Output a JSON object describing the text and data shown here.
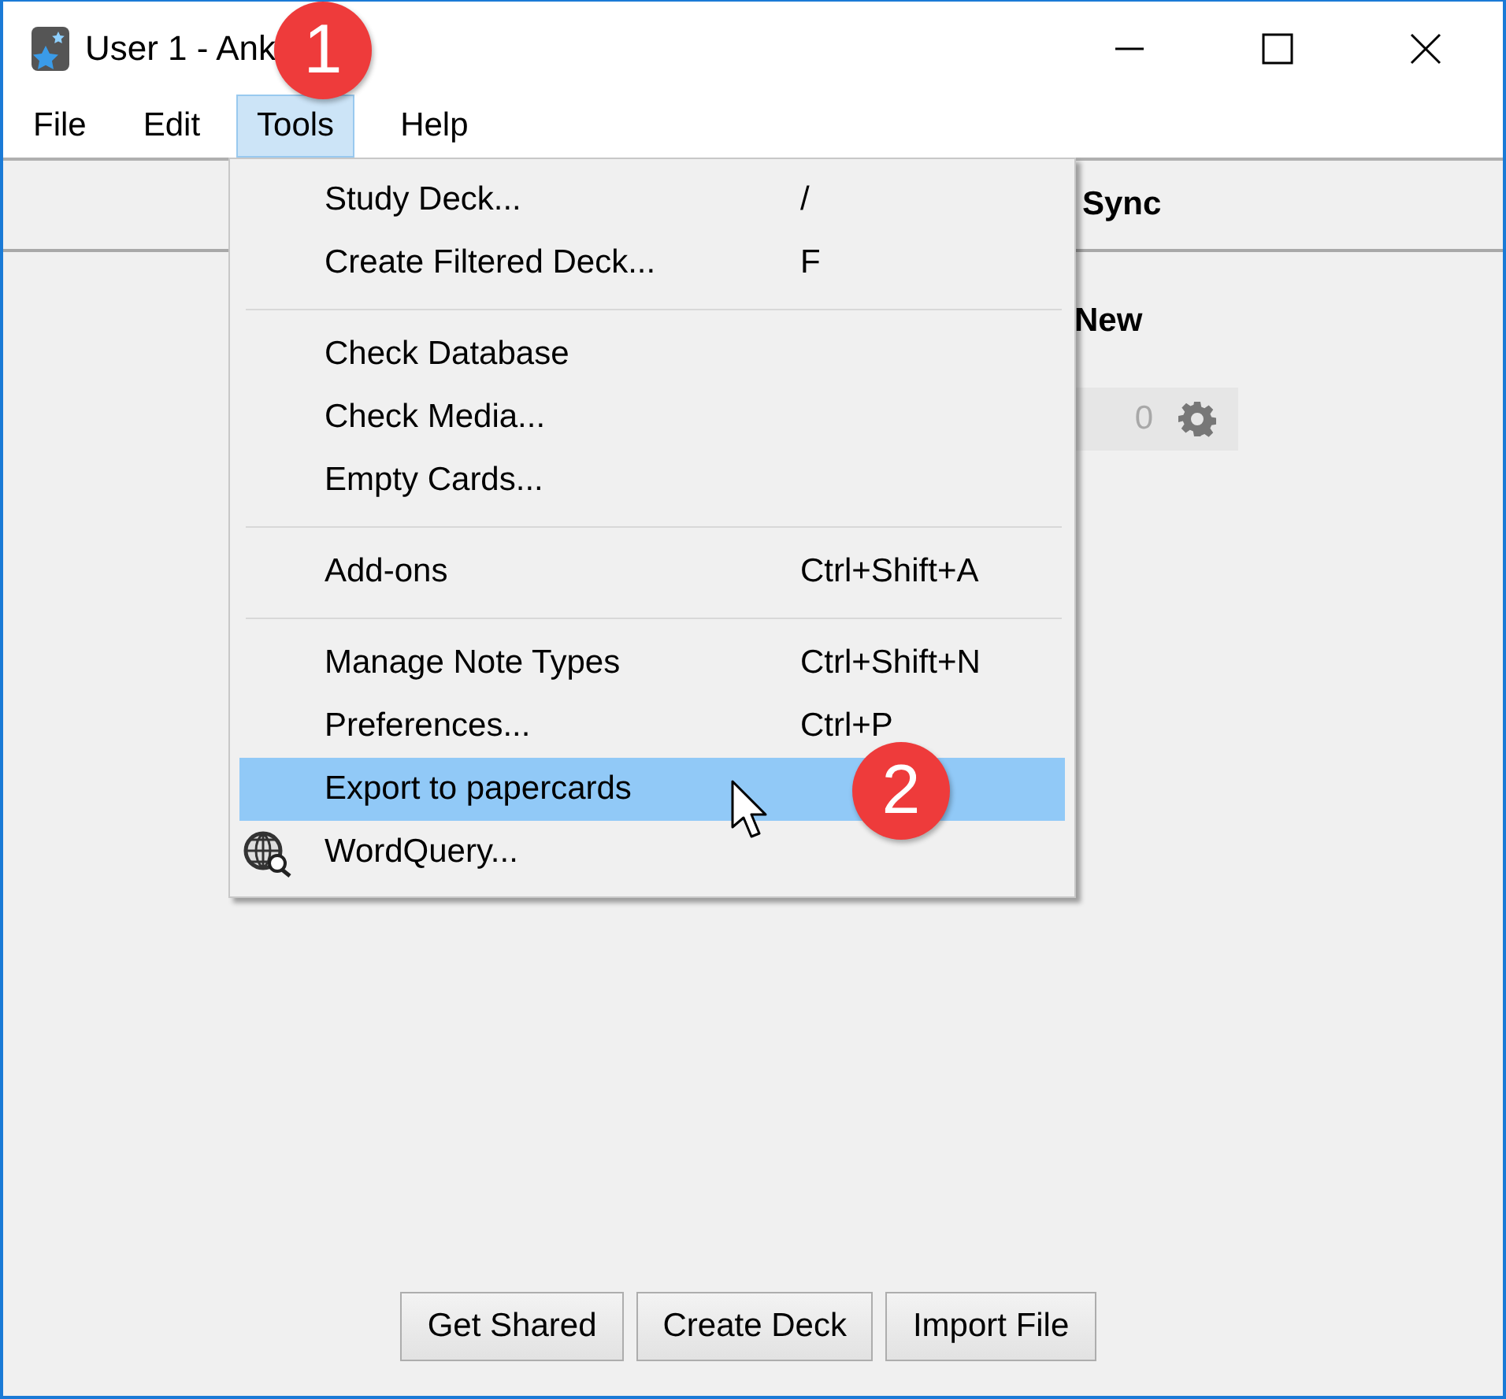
{
  "window": {
    "title": "User 1 - Ank"
  },
  "menu_bar": [
    {
      "label": "File",
      "selected": false
    },
    {
      "label": "Edit",
      "selected": false
    },
    {
      "label": "Tools",
      "selected": true
    },
    {
      "label": "Help",
      "selected": false
    }
  ],
  "toolbar": {
    "sync": "Sync"
  },
  "deck_list": {
    "column": "New",
    "rows": [
      {
        "new": "0"
      }
    ]
  },
  "tools_menu": {
    "items": [
      {
        "kind": "item",
        "label": "Study Deck...",
        "shortcut": "/",
        "selected": false
      },
      {
        "kind": "item",
        "label": "Create Filtered Deck...",
        "shortcut": "F",
        "selected": false
      },
      {
        "kind": "separator"
      },
      {
        "kind": "item",
        "label": "Check Database",
        "selected": false
      },
      {
        "kind": "item",
        "label": "Check Media...",
        "selected": false
      },
      {
        "kind": "item",
        "label": "Empty Cards...",
        "selected": false
      },
      {
        "kind": "separator"
      },
      {
        "kind": "item",
        "label": "Add-ons",
        "shortcut": "Ctrl+Shift+A",
        "selected": false
      },
      {
        "kind": "separator"
      },
      {
        "kind": "item",
        "label": "Manage Note Types",
        "shortcut": "Ctrl+Shift+N",
        "selected": false
      },
      {
        "kind": "item",
        "label": "Preferences...",
        "shortcut": "Ctrl+P",
        "selected": false
      },
      {
        "kind": "item",
        "label": "Export to papercards",
        "selected": true
      },
      {
        "kind": "icon_item",
        "label": "WordQuery...",
        "selected": false
      }
    ]
  },
  "buttons": [
    "Get Shared",
    "Create Deck",
    "Import File"
  ],
  "callouts": [
    "1",
    "2"
  ]
}
